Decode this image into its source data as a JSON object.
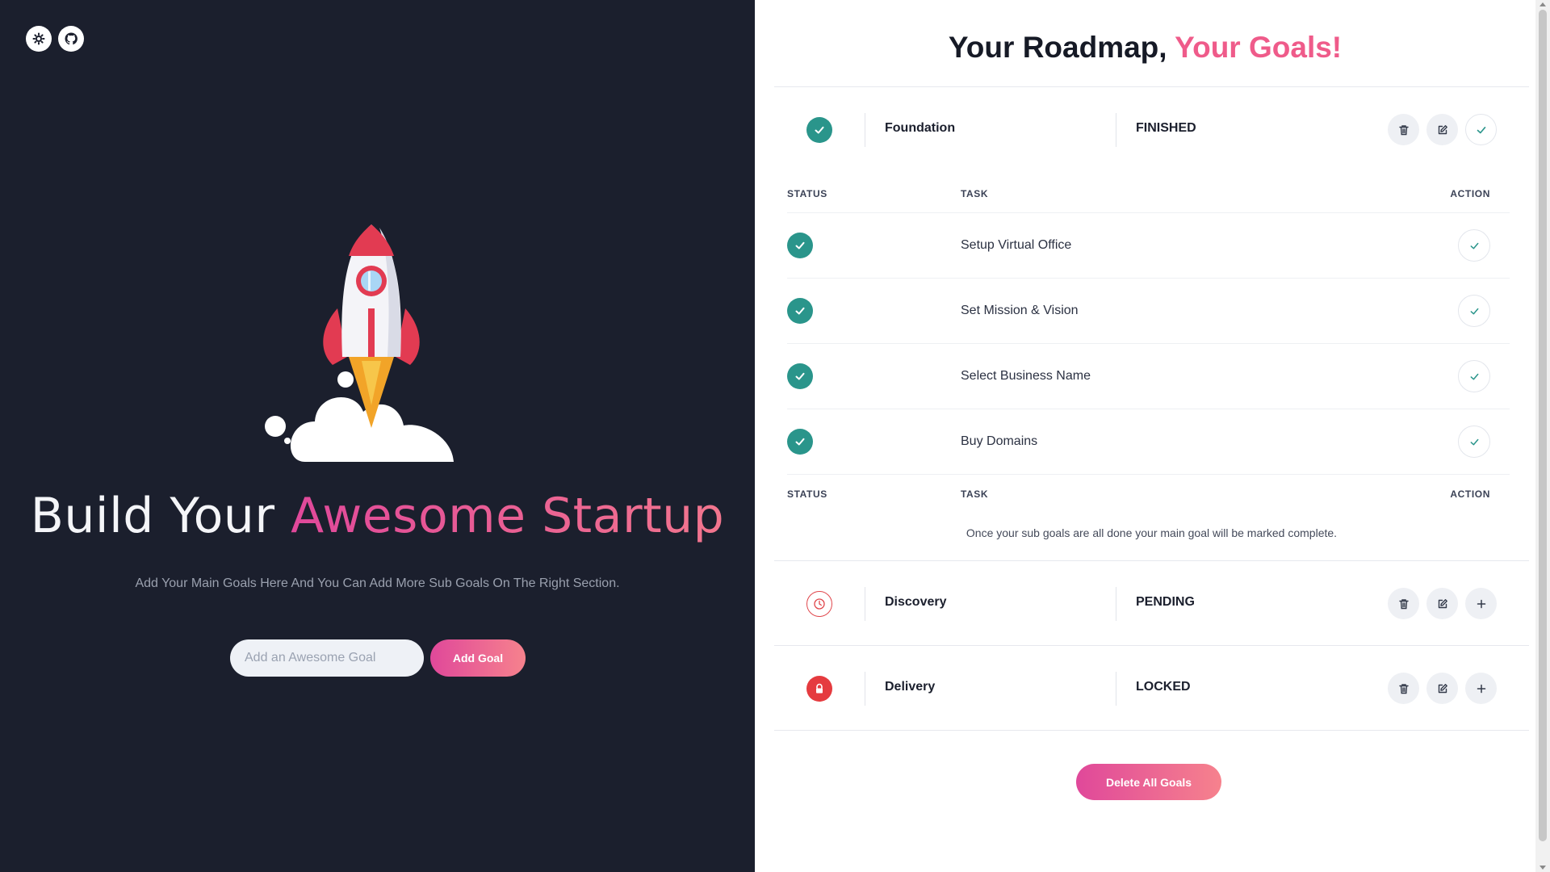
{
  "left": {
    "hero_title_part1": "Build Your ",
    "hero_title_part2": "Awesome Startup",
    "hero_subtitle": "Add Your Main Goals Here And You Can Add More Sub Goals On The Right Section.",
    "goal_input_placeholder": "Add an Awesome Goal",
    "add_goal_label": "Add Goal",
    "icons": [
      "theme-gear-icon",
      "github-icon"
    ]
  },
  "right": {
    "title_part1": "Your Roadmap, ",
    "title_part2": "Your Goals!",
    "goals": [
      {
        "name": "Foundation",
        "status": "FINISHED",
        "status_icon": "check-icon",
        "actions": [
          "trash-icon",
          "edit-icon",
          "check-icon"
        ],
        "subgoals": {
          "headers": {
            "status": "STATUS",
            "task": "TASK",
            "action": "ACTION"
          },
          "rows": [
            {
              "task": "Setup Virtual Office"
            },
            {
              "task": "Set Mission & Vision"
            },
            {
              "task": "Select Business Name"
            },
            {
              "task": "Buy Domains"
            }
          ],
          "note": "Once your sub goals are all done your main goal will be marked complete."
        }
      },
      {
        "name": "Discovery",
        "status": "PENDING",
        "status_icon": "clock-icon",
        "actions": [
          "trash-icon",
          "edit-icon",
          "plus-icon"
        ]
      },
      {
        "name": "Delivery",
        "status": "LOCKED",
        "status_icon": "lock-icon",
        "actions": [
          "trash-icon",
          "edit-icon",
          "plus-icon"
        ]
      }
    ],
    "delete_all_label": "Delete All Goals"
  },
  "colors": {
    "dark_bg": "#1b1f2d",
    "accent_start": "#e0489a",
    "accent_end": "#f6828d",
    "done_green": "#2a958b",
    "locked_red": "#e53b3f"
  }
}
